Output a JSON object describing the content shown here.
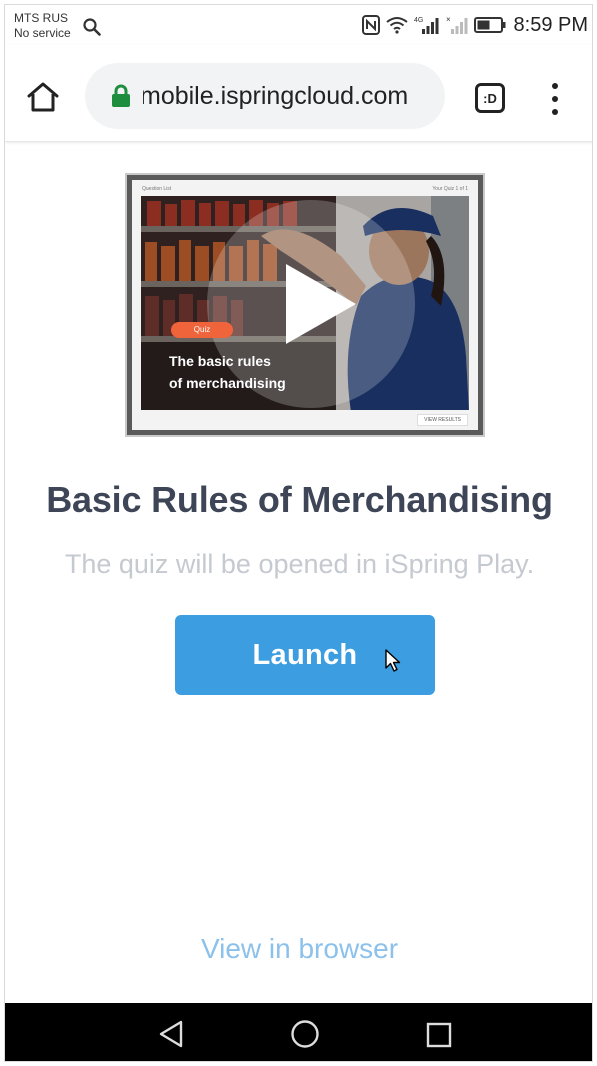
{
  "status_bar": {
    "carrier": "MTS RUS",
    "service": "No service",
    "time": "8:59 PM",
    "network": "4G"
  },
  "browser": {
    "url": "mobile.ispringcloud.com",
    "tabs_label": ":D"
  },
  "thumbnail": {
    "header_left": "Question List",
    "header_right": "Your Quiz 1 of 1",
    "badge": "Quiz",
    "title_line1": "The basic rules",
    "title_line2": "of merchandising",
    "results_button": "VIEW RESULTS"
  },
  "main": {
    "title": "Basic Rules of Merchandising",
    "subtitle": "The quiz will be opened in iSpring Play.",
    "launch_label": "Launch",
    "view_in_browser": "View in browser"
  },
  "colors": {
    "accent": "#3c9ee0",
    "title": "#3d4556",
    "subtitle": "#c5c9d0",
    "link": "#8cc1eb",
    "quiz_badge": "#f0643c",
    "lock": "#1e8e3e"
  },
  "icons": [
    "search-icon",
    "nfc-icon",
    "wifi-icon",
    "signal-icon",
    "battery-icon",
    "home-icon",
    "lock-icon",
    "tabs-icon",
    "menu-icon",
    "play-icon",
    "cursor-icon",
    "back-icon",
    "home-circle-icon",
    "recents-icon"
  ]
}
